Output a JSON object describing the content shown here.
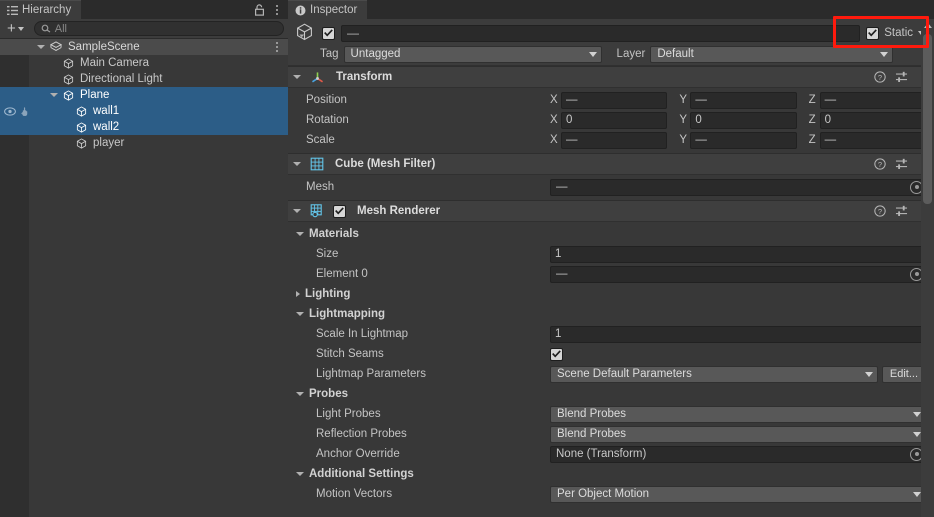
{
  "hierarchy": {
    "tab_label": "Hierarchy",
    "tab_icon": "hierarchy-icon",
    "lock_icon": "lock-icon",
    "menu_icon": "kebab-menu-icon",
    "toolbar": {
      "add_label": "+",
      "add_dropdown_icon": "chevron-down-icon",
      "search_icon": "search-icon",
      "search_value": "",
      "search_placeholder": "All"
    },
    "items": [
      {
        "label": "SampleScene",
        "depth": 0,
        "icon": "scene-icon",
        "expanded": true,
        "selected": false,
        "is_scene": true,
        "has_kebab": true,
        "vis_icons": false
      },
      {
        "label": "Main Camera",
        "depth": 1,
        "icon": "gameobject-cube-icon",
        "expanded": null,
        "selected": false,
        "is_scene": false,
        "has_kebab": false,
        "vis_icons": false
      },
      {
        "label": "Directional Light",
        "depth": 1,
        "icon": "gameobject-cube-icon",
        "expanded": null,
        "selected": false,
        "is_scene": false,
        "has_kebab": false,
        "vis_icons": false
      },
      {
        "label": "Plane",
        "depth": 1,
        "icon": "gameobject-cube-icon",
        "expanded": true,
        "selected": true,
        "is_scene": false,
        "has_kebab": false,
        "vis_icons": false
      },
      {
        "label": "wall1",
        "depth": 2,
        "icon": "gameobject-cube-icon",
        "expanded": null,
        "selected": true,
        "is_scene": false,
        "has_kebab": false,
        "vis_icons": true
      },
      {
        "label": "wall2",
        "depth": 2,
        "icon": "gameobject-cube-icon",
        "expanded": null,
        "selected": true,
        "is_scene": false,
        "has_kebab": false,
        "vis_icons": false
      },
      {
        "label": "player",
        "depth": 2,
        "icon": "gameobject-cube-icon",
        "expanded": null,
        "selected": false,
        "is_scene": false,
        "has_kebab": false,
        "vis_icons": false
      }
    ]
  },
  "inspector": {
    "tab_label": "Inspector",
    "tab_icon": "info-icon",
    "gameobject": {
      "icon": "gameobject-cube-icon",
      "enabled": true,
      "name_value": "—",
      "static_label": "Static",
      "static_checked": true,
      "static_dropdown_icon": "chevron-down-icon",
      "tag_label": "Tag",
      "tag_value": "Untagged",
      "layer_label": "Layer",
      "layer_value": "Default"
    },
    "components": [
      {
        "name": "transform-component",
        "title": "Transform",
        "icon": "transform-gizmo-icon",
        "expanded": true,
        "has_enable_toggle": false,
        "header_icons": [
          "help-icon",
          "preset-icon",
          "kebab-menu-icon"
        ],
        "rows": [
          {
            "type": "vector3",
            "label": "Position",
            "axes": [
              "X",
              "Y",
              "Z"
            ],
            "values": [
              "—",
              "—",
              "—"
            ]
          },
          {
            "type": "vector3",
            "label": "Rotation",
            "axes": [
              "X",
              "Y",
              "Z"
            ],
            "values": [
              "0",
              "0",
              "0"
            ]
          },
          {
            "type": "vector3",
            "label": "Scale",
            "axes": [
              "X",
              "Y",
              "Z"
            ],
            "values": [
              "—",
              "—",
              "—"
            ]
          }
        ]
      },
      {
        "name": "mesh-filter-component",
        "title": "Cube (Mesh Filter)",
        "icon": "mesh-filter-icon",
        "expanded": true,
        "has_enable_toggle": false,
        "header_icons": [
          "help-icon",
          "preset-icon",
          "kebab-menu-icon"
        ],
        "rows": [
          {
            "type": "object",
            "label": "Mesh",
            "value": "—",
            "picker_icon": "object-picker-icon"
          }
        ]
      },
      {
        "name": "mesh-renderer-component",
        "title": "Mesh Renderer",
        "icon": "mesh-renderer-icon",
        "expanded": true,
        "has_enable_toggle": true,
        "enabled": true,
        "header_icons": [
          "help-icon",
          "preset-icon",
          "kebab-menu-icon"
        ],
        "rows": [
          {
            "type": "section",
            "label": "Materials",
            "expanded": true
          },
          {
            "type": "text",
            "label": "Size",
            "value": "1"
          },
          {
            "type": "object",
            "label": "Element 0",
            "value": "—",
            "picker_icon": "object-picker-icon"
          },
          {
            "type": "section",
            "label": "Lighting",
            "expanded": false
          },
          {
            "type": "section",
            "label": "Lightmapping",
            "expanded": true
          },
          {
            "type": "text",
            "label": "Scale In Lightmap",
            "value": "1"
          },
          {
            "type": "checkbox",
            "label": "Stitch Seams",
            "checked": true
          },
          {
            "type": "dropdown-edit",
            "label": "Lightmap Parameters",
            "value": "Scene Default Parameters",
            "button_label": "Edit..."
          },
          {
            "type": "section",
            "label": "Probes",
            "expanded": true
          },
          {
            "type": "dropdown",
            "label": "Light Probes",
            "value": "Blend Probes"
          },
          {
            "type": "dropdown",
            "label": "Reflection Probes",
            "value": "Blend Probes"
          },
          {
            "type": "object",
            "label": "Anchor Override",
            "value": "None (Transform)",
            "picker_icon": "object-picker-icon"
          },
          {
            "type": "section",
            "label": "Additional Settings",
            "expanded": true
          },
          {
            "type": "dropdown",
            "label": "Motion Vectors",
            "value": "Per Object Motion"
          }
        ]
      }
    ],
    "scrollbar": {
      "up_arrow_icon": "scroll-up-arrow-icon"
    }
  },
  "annotation": {
    "highlight_color": "#ff1a0d",
    "target": "static-checkbox-group"
  }
}
